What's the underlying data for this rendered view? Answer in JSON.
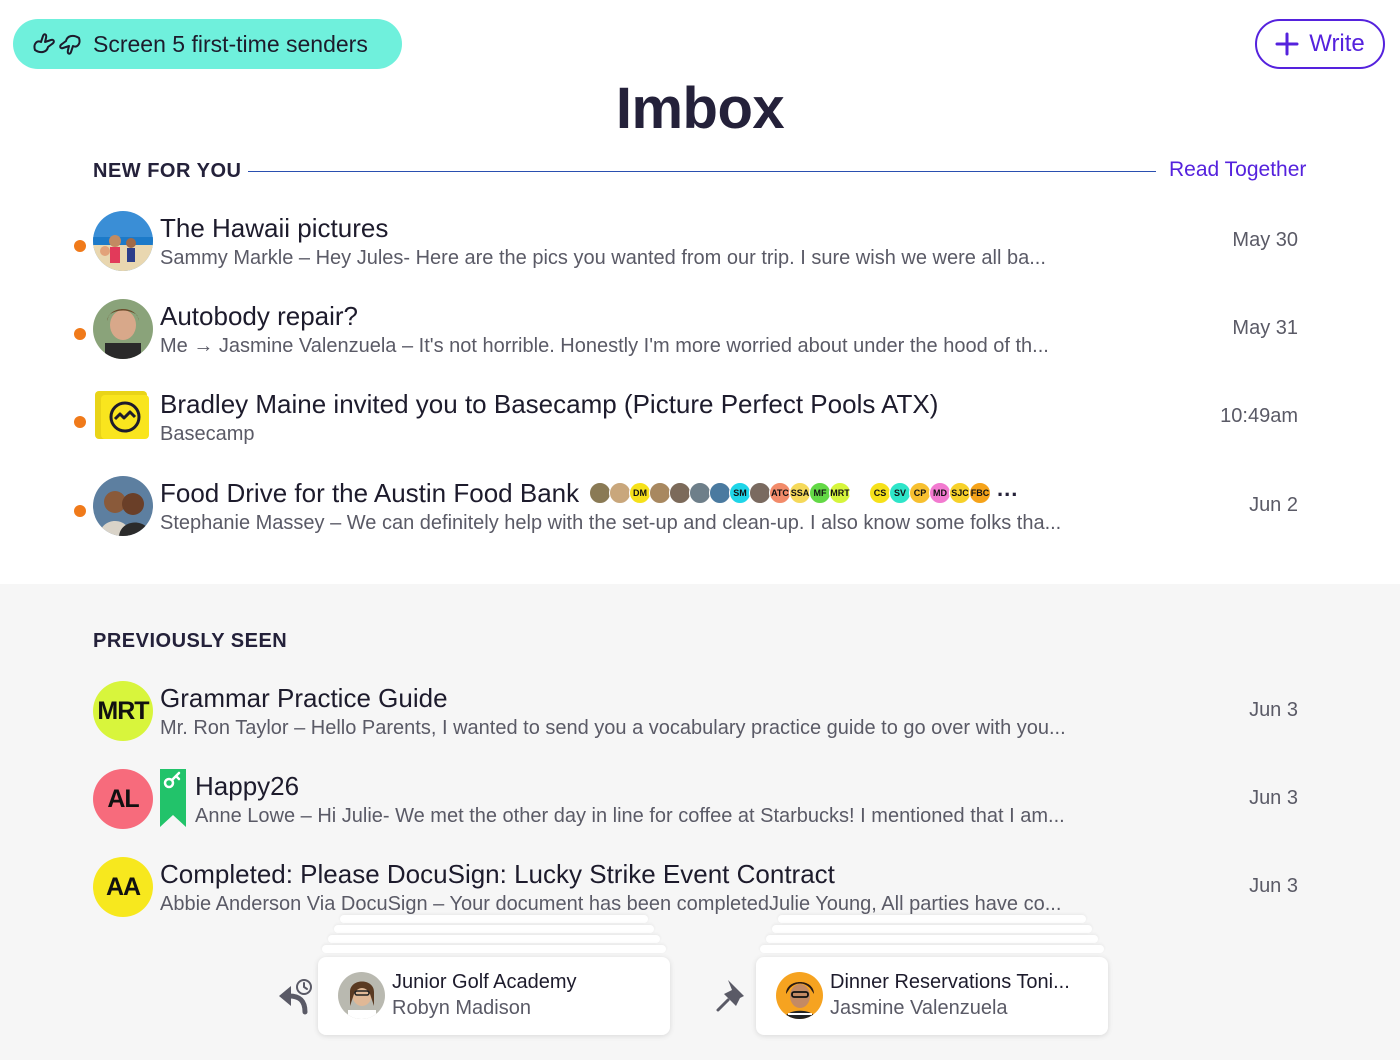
{
  "header": {
    "screen_label": "Screen 5 first-time senders",
    "write_label": "Write",
    "title": "Imbox"
  },
  "colors": {
    "accent": "#5522dd",
    "screen_button": "#6ff0dc",
    "unread_dot": "#f07a1a"
  },
  "new_for_you": {
    "heading": "NEW FOR YOU",
    "read_together": "Read Together",
    "items": [
      {
        "subject": "The Hawaii pictures",
        "snippet": "Sammy Markle – Hey Jules- Here are the pics you wanted from our trip. I sure wish we were all ba...",
        "date": "May 30",
        "unread": true
      },
      {
        "subject": "Autobody repair?",
        "snippet": "Me → Jasmine Valenzuela – It's not horrible. Honestly I'm more worried about under the hood of th...",
        "date": "May 31",
        "unread": true
      },
      {
        "subject": "Bradley Maine invited you to Basecamp (Picture Perfect Pools ATX)",
        "snippet": "Basecamp",
        "date": "10:49am",
        "unread": true
      },
      {
        "subject": "Food Drive for the Austin Food Bank",
        "snippet": "Stephanie Massey – We can definitely help with the set-up and clean-up. I also know some folks tha...",
        "date": "Jun 2",
        "unread": true
      }
    ],
    "participants": [
      {
        "initials": "",
        "color": "#8a7a55"
      },
      {
        "initials": "",
        "color": "#c9a77c"
      },
      {
        "initials": "DM",
        "color": "#f6e11a"
      },
      {
        "initials": "",
        "color": "#a88860"
      },
      {
        "initials": "",
        "color": "#7c6a5a"
      },
      {
        "initials": "",
        "color": "#6e7f8a"
      },
      {
        "initials": "",
        "color": "#4a7aa0"
      },
      {
        "initials": "SM",
        "color": "#1fd5e8"
      },
      {
        "initials": "",
        "color": "#7a6a60"
      },
      {
        "initials": "ATC",
        "color": "#f28b6a"
      },
      {
        "initials": "SSA",
        "color": "#f5d95a"
      },
      {
        "initials": "MF",
        "color": "#63d946"
      },
      {
        "initials": "MRT",
        "color": "#d6f53c"
      },
      {
        "initials": "",
        "color": "#ffffff"
      },
      {
        "initials": "CS",
        "color": "#f6e11a"
      },
      {
        "initials": "SV",
        "color": "#2ee5c9"
      },
      {
        "initials": "CP",
        "color": "#f7c030"
      },
      {
        "initials": "MD",
        "color": "#f27ad0"
      },
      {
        "initials": "SJC",
        "color": "#f7d12a"
      },
      {
        "initials": "FBC",
        "color": "#f5a31a"
      }
    ],
    "more_label": "..."
  },
  "previously_seen": {
    "heading": "PREVIOUSLY SEEN",
    "items": [
      {
        "initials": "MRT",
        "avatar_color": "#d8f53c",
        "subject": "Grammar Practice Guide",
        "snippet": "Mr. Ron Taylor – Hello Parents, I wanted to send you a vocabulary practice guide to go over with you...",
        "date": "Jun 3"
      },
      {
        "initials": "AL",
        "avatar_color": "#f76b7c",
        "subject": "Happy26",
        "snippet": "Anne Lowe – Hi Julie- We met the other day in line for coffee at Starbucks! I mentioned that I am...",
        "date": "Jun 3"
      },
      {
        "initials": "AA",
        "avatar_color": "#f7e81e",
        "subject": "Completed: Please DocuSign: Lucky Strike Event Contract",
        "snippet": "Abbie Anderson Via DocuSign – Your document has been completedJulie Young, All parties have co...",
        "date": "Jun 3"
      }
    ]
  },
  "tray": {
    "reply_later": {
      "title": "Junior Golf Academy",
      "sender": "Robyn Madison"
    },
    "set_aside": {
      "title": "Dinner Reservations Toni...",
      "sender": "Jasmine Valenzuela"
    }
  }
}
